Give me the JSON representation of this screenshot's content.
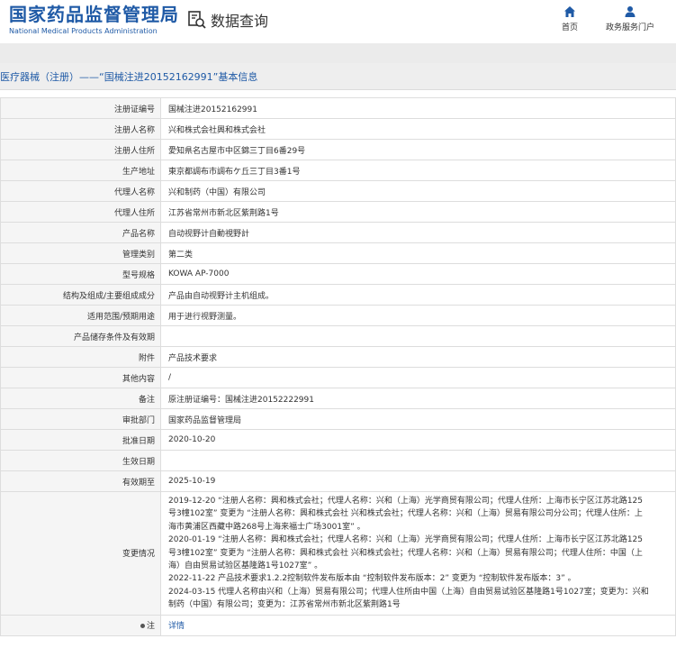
{
  "header": {
    "logo_cn": "国家药品监督管理局",
    "logo_en": "National Medical Products Administration",
    "data_query": "数据查询",
    "nav": {
      "home": "首页",
      "gov_service": "政务服务门户"
    }
  },
  "page_title": "医疗器械（注册）——“国械注进20152162991”基本信息",
  "fields": [
    {
      "label": "注册证编号",
      "value": "国械注进20152162991"
    },
    {
      "label": "注册人名称",
      "value": "兴和株式会社興和株式会社"
    },
    {
      "label": "注册人住所",
      "value": "愛知県名古屋市中区錦三丁目6番29号"
    },
    {
      "label": "生产地址",
      "value": "東京都調布市調布ケ丘三丁目3番1号"
    },
    {
      "label": "代理人名称",
      "value": "兴和制药（中国）有限公司"
    },
    {
      "label": "代理人住所",
      "value": "江苏省常州市新北区紫荆路1号"
    },
    {
      "label": "产品名称",
      "value": "自动视野计自動視野計"
    },
    {
      "label": "管理类别",
      "value": "第二类"
    },
    {
      "label": "型号规格",
      "value": "KOWA AP-7000"
    },
    {
      "label": "结构及组成/主要组成成分",
      "value": "产品由自动视野计主机组成。"
    },
    {
      "label": "适用范围/预期用途",
      "value": "用于进行视野测量。"
    },
    {
      "label": "产品储存条件及有效期",
      "value": ""
    },
    {
      "label": "附件",
      "value": "产品技术要求"
    },
    {
      "label": "其他内容",
      "value": "/"
    },
    {
      "label": "备注",
      "value": "原注册证编号：国械注进20152222991"
    },
    {
      "label": "审批部门",
      "value": "国家药品监督管理局"
    },
    {
      "label": "批准日期",
      "value": "2020-10-20"
    },
    {
      "label": "生效日期",
      "value": ""
    },
    {
      "label": "有效期至",
      "value": "2025-10-19"
    }
  ],
  "changes": {
    "label": "变更情况",
    "lines": [
      "2019-12-20 “注册人名称：興和株式会社；代理人名称：兴和（上海）光学商贸有限公司；代理人住所：上海市长宁区江苏北路125",
      "号3幢102室” 变更为 “注册人名称：興和株式会社 兴和株式会社；代理人名称：兴和（上海）贸易有限公司分公司；代理人住所：上",
      "海市黄浦区西藏中路268号上海来福士广场3001室” 。",
      "2020-01-19 “注册人名称：興和株式会社；代理人名称：兴和（上海）光学商贸有限公司；代理人住所：上海市长宁区江苏北路125",
      "号3幢102室” 变更为 “注册人名称：興和株式会社 兴和株式会社；代理人名称：兴和（上海）贸易有限公司；代理人住所：中国（上",
      "海）自由贸易试验区基隆路1号1027室” 。",
      "2022-11-22 产品技术要求1.2.2控制软件发布版本由 “控制软件发布版本：2” 变更为 “控制软件发布版本：3” 。",
      "2024-03-15 代理人名称由兴和（上海）贸易有限公司；代理人住所由中国（上海）自由贸易试验区基隆路1号1027室；变更为：兴和",
      "制药（中国）有限公司；变更为：江苏省常州市新北区紫荆路1号"
    ]
  },
  "note": {
    "label": "注",
    "value": "详情"
  }
}
